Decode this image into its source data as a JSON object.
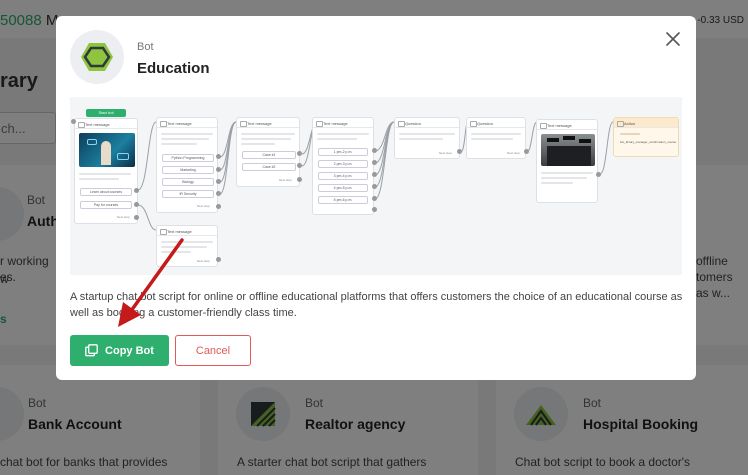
{
  "background": {
    "balance_number": "50088",
    "balance_suffix": " Ma",
    "usd_text": "USD -0.33 USD",
    "library_title": "rary",
    "search_placeholder": "ch...",
    "cards": [
      {
        "type": "Bot",
        "title": "Auth",
        "desc_line1": "r working w",
        "desc_line2": "es."
      },
      {
        "type": "Bot",
        "title": "Bank Account",
        "desc": "chat bot for banks that provides"
      },
      {
        "type": "Bot",
        "title": "Realtor agency",
        "desc": "A starter chat bot script that gathers"
      },
      {
        "type": "Bot",
        "title": "Hospital Booking",
        "desc": "Chat bot script to book a doctor's"
      }
    ],
    "right_card": {
      "line1": "offline",
      "line2": "tomers",
      "line3": "as w..."
    },
    "link_fragment": "s"
  },
  "modal": {
    "type_label": "Bot",
    "title": "Education",
    "description": "A startup chat bot script for online or offline educational platforms that offers customers the choice of an educational course as well as booking a customer-friendly class time.",
    "copy_label": "Copy Bot",
    "cancel_label": "Cancel",
    "colors": {
      "accent": "#2eaf6e",
      "danger": "#e05a5a",
      "annotation_arrow": "#c41a1a"
    }
  },
  "flow": {
    "start_label": "Start bot",
    "node_header": "Text message",
    "question_header": "Question",
    "action_header": "Action",
    "next_step": "Next step",
    "node1_buttons": [
      "Learn about courses",
      "Pay for courses"
    ],
    "node2_buttons": [
      "Python Programming",
      "Marketing",
      "Biology",
      "IR Security"
    ],
    "node3_buttons": [
      "Case #1",
      "Case #2"
    ],
    "node4_buttons": [
      "1 pm-2 p.m.",
      "2 pm-3 p.m.",
      "3 pm-4 p.m.",
      "4 pm-5 p.m.",
      "5 pm-6 p.m."
    ],
    "action_text": "bot_library_manager_confirmation_course"
  }
}
